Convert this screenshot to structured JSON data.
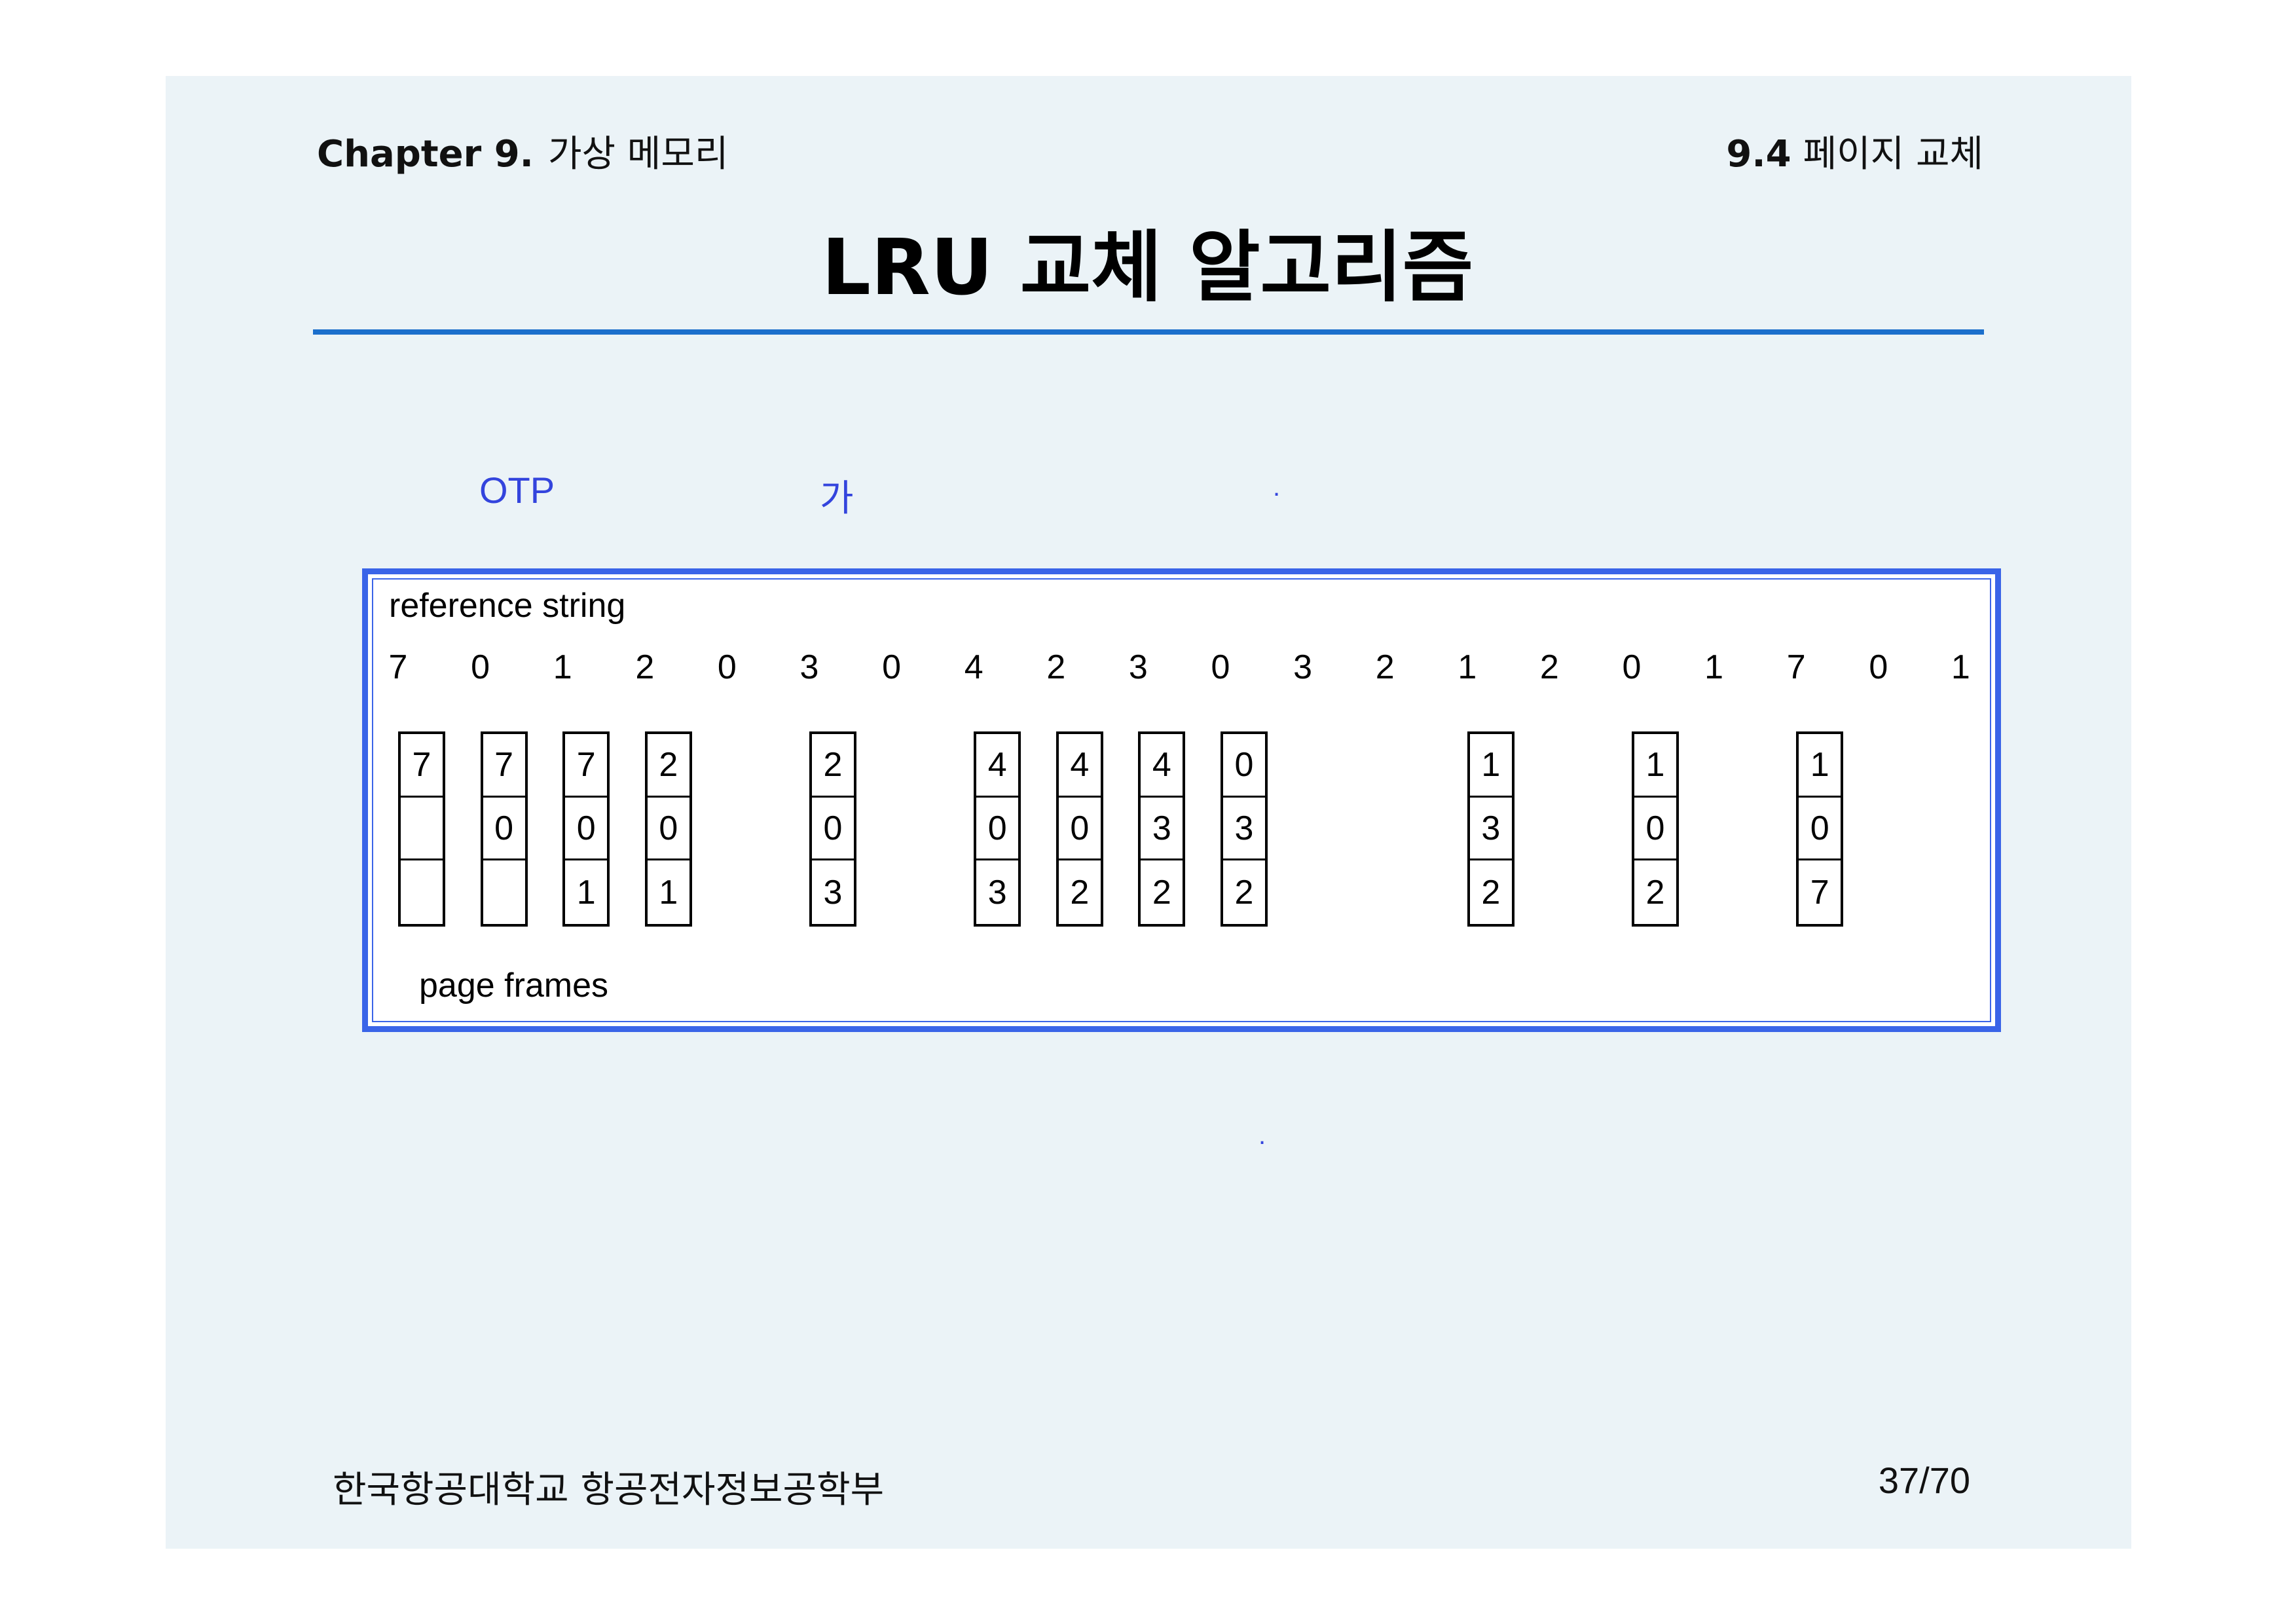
{
  "header": {
    "chapter_label": "Chapter 9.",
    "chapter_title": "가상 메모리",
    "section_label": "9.4",
    "section_title": "페이지 교체"
  },
  "title": "LRU 교체 알고리즘",
  "notes": {
    "otp": "OTP",
    "ga": "가",
    "dot1": ".",
    "dot2": "."
  },
  "figure": {
    "reference_label": "reference string",
    "frames_label": "page frames",
    "reference_string": [
      "7",
      "0",
      "1",
      "2",
      "0",
      "3",
      "0",
      "4",
      "2",
      "3",
      "0",
      "3",
      "2",
      "1",
      "2",
      "0",
      "1",
      "7",
      "0",
      "1"
    ],
    "frame_columns": [
      {
        "ref_index": 0,
        "cells": [
          "7",
          "",
          ""
        ]
      },
      {
        "ref_index": 1,
        "cells": [
          "7",
          "0",
          ""
        ]
      },
      {
        "ref_index": 2,
        "cells": [
          "7",
          "0",
          "1"
        ]
      },
      {
        "ref_index": 3,
        "cells": [
          "2",
          "0",
          "1"
        ]
      },
      {
        "ref_index": 5,
        "cells": [
          "2",
          "0",
          "3"
        ]
      },
      {
        "ref_index": 7,
        "cells": [
          "4",
          "0",
          "3"
        ]
      },
      {
        "ref_index": 8,
        "cells": [
          "4",
          "0",
          "2"
        ]
      },
      {
        "ref_index": 9,
        "cells": [
          "4",
          "3",
          "2"
        ]
      },
      {
        "ref_index": 10,
        "cells": [
          "0",
          "3",
          "2"
        ]
      },
      {
        "ref_index": 13,
        "cells": [
          "1",
          "3",
          "2"
        ]
      },
      {
        "ref_index": 15,
        "cells": [
          "1",
          "0",
          "2"
        ]
      },
      {
        "ref_index": 17,
        "cells": [
          "1",
          "0",
          "7"
        ]
      }
    ]
  },
  "footer": {
    "school": "한국항공대학교 항공전자정보공학부",
    "page": "37/70"
  },
  "colors": {
    "slide_bg": "#ebf3f7",
    "rule": "#1b6fcc",
    "figure_border": "#3a64e8",
    "note_text": "#3344dd"
  }
}
